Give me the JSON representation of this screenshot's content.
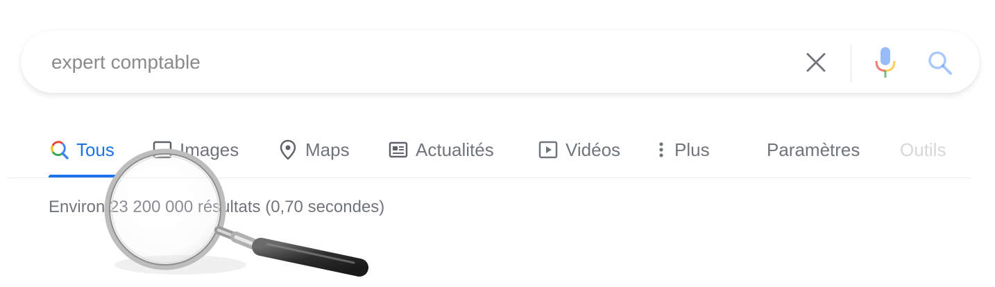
{
  "search": {
    "query": "expert comptable",
    "clear_icon": "close-icon",
    "mic_icon": "microphone-icon",
    "search_icon": "search-icon"
  },
  "tabs": [
    {
      "label": "Tous",
      "icon": "search-icon",
      "active": true
    },
    {
      "label": "Images",
      "icon": "image-icon"
    },
    {
      "label": "Maps",
      "icon": "map-pin-icon"
    },
    {
      "label": "Actualités",
      "icon": "news-icon"
    },
    {
      "label": "Vidéos",
      "icon": "play-icon"
    },
    {
      "label": "Plus",
      "icon": "more-vert-icon"
    }
  ],
  "tools": {
    "settings_label": "Paramètres",
    "tools_label": "Outils"
  },
  "results_stats": "Environ 23 200 000 résultats (0,70 secondes)",
  "colors": {
    "accent": "#1a73e8",
    "text_muted": "#70757a",
    "google_blue": "#4285f4",
    "google_red": "#ea4335",
    "google_yellow": "#fbbc05",
    "google_green": "#34a853"
  },
  "overlay": {
    "icon": "magnifying-glass-icon"
  }
}
